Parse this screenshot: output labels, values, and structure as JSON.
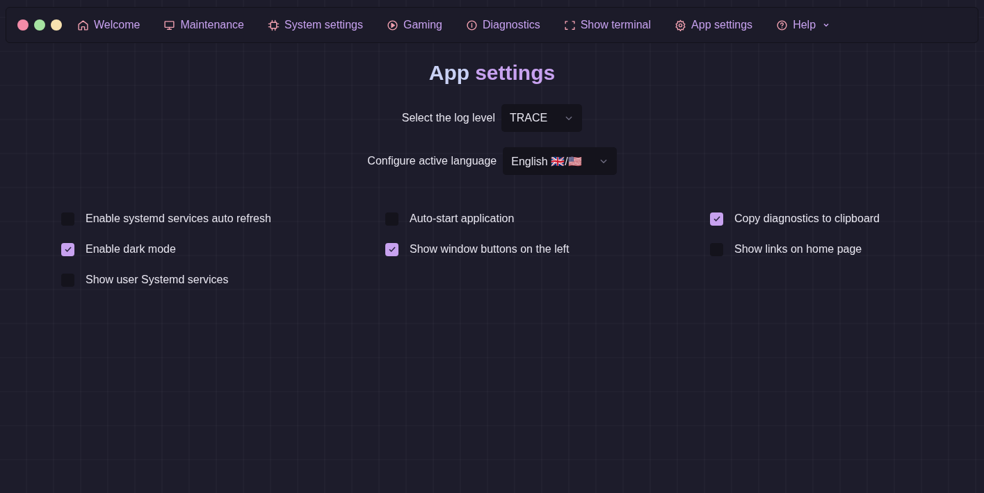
{
  "window_controls": [
    {
      "color": "#f38ba8"
    },
    {
      "color": "#a6e3a1"
    },
    {
      "color": "#f9e2af"
    }
  ],
  "nav": [
    {
      "label": "Welcome",
      "has_menu": false
    },
    {
      "label": "Maintenance",
      "has_menu": false
    },
    {
      "label": "System settings",
      "has_menu": false
    },
    {
      "label": "Gaming",
      "has_menu": false
    },
    {
      "label": "Diagnostics",
      "has_menu": false
    },
    {
      "label": "Show terminal",
      "has_menu": false
    },
    {
      "label": "App settings",
      "has_menu": false
    },
    {
      "label": "Help",
      "has_menu": true
    }
  ],
  "heading": [
    "App",
    "settings"
  ],
  "selects": [
    {
      "label": "Select the log level",
      "value": "TRACE"
    },
    {
      "label": "Configure active language",
      "value": "English 🇬🇧/🇺🇸"
    }
  ],
  "option_columns": [
    [
      {
        "label": "Enable systemd services auto refresh",
        "checked": false
      },
      {
        "label": "Enable dark mode",
        "checked": true
      },
      {
        "label": "Show user Systemd services",
        "checked": false
      }
    ],
    [
      {
        "label": "Auto-start application",
        "checked": false
      },
      {
        "label": "Show window buttons on the left",
        "checked": true
      }
    ],
    [
      {
        "label": "Copy diagnostics to clipboard",
        "checked": true
      },
      {
        "label": "Show links on home page",
        "checked": false
      }
    ]
  ]
}
